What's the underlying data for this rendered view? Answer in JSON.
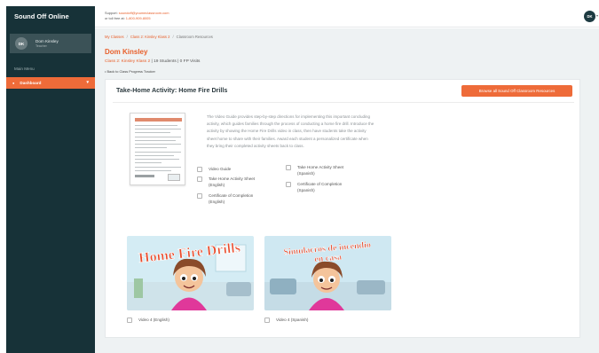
{
  "sidebar": {
    "brand": "Sound Off Online",
    "user": {
      "initials": "DK",
      "name": "Dom Kinsley",
      "role": "Teacher"
    },
    "menu_label": "Main Menu",
    "nav": [
      {
        "label": "Dashboard",
        "icon": "dot-icon",
        "active": true
      }
    ]
  },
  "topbar": {
    "support_prefix": "Support: ",
    "support_email": "soundoff@youmeclassroom.com",
    "tollfree_prefix": "or toll free at: ",
    "tollfree_number": "1-800-909-8005",
    "avatar_initials": "DK"
  },
  "breadcrumb": {
    "items": [
      "My Classes",
      "Class 2: Kinsley Klass 2",
      "Classroom Resources"
    ]
  },
  "page": {
    "teacher_name": "Dom Kinsley",
    "class_name": "Class 2: Kinsley Klass 2",
    "students": "19 Students",
    "visits": "0 FP Visits",
    "back_link": "• Back to Class Progress Tracker"
  },
  "card": {
    "title": "Take-Home Activity: Home Fire Drills",
    "browse_button": "Browse all Sound Off Classroom Resources",
    "description": "The Video Guide provides step-by-step directions for implementing this important concluding activity, which guides families through the process of conducting a home fire drill. Introduce the activity by showing the Home Fire Drills video in class, then have students take the activity sheet home to share with their families. Award each student a personalized certificate when they bring their completed activity sheets back to class.",
    "files": [
      {
        "label": "Video Guide"
      },
      {
        "label": "Take Home Activity Sheet (English)"
      },
      {
        "label": "Certificate of Completion (English)"
      },
      {
        "label": "Take Home Activity Sheet (Spanish)"
      },
      {
        "label": "Certificate of Completion (Spanish)"
      }
    ],
    "videos": [
      {
        "thumb_title": "Home Fire Drills",
        "label": "Video 4 (English)"
      },
      {
        "thumb_title_line1": "Simulacros de incendio",
        "thumb_title_line2": "en casa",
        "label": "Video 4 (Spanish)"
      }
    ]
  },
  "colors": {
    "accent": "#ee6b39",
    "sidebar_bg": "#173238",
    "content_bg": "#eef2f3"
  }
}
